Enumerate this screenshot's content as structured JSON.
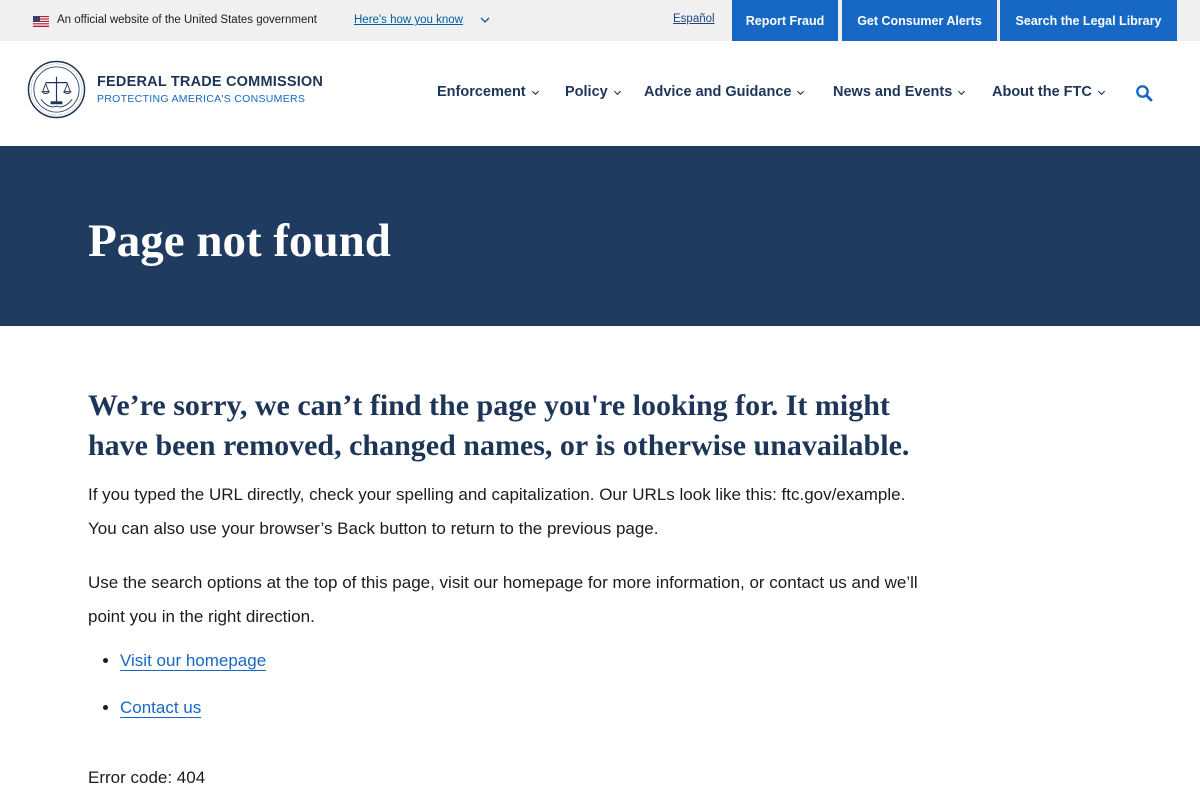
{
  "gov_banner": {
    "text": "An official website of the United States government",
    "link": "Here's how you know"
  },
  "utility": {
    "espanol": "Español",
    "report_fraud": "Report Fraud",
    "consumer_alerts": "Get Consumer Alerts",
    "legal_library": "Search the Legal Library"
  },
  "logo": {
    "title": "FEDERAL TRADE COMMISSION",
    "subtitle": "PROTECTING AMERICA'S CONSUMERS"
  },
  "nav": {
    "items": [
      {
        "label": "Enforcement"
      },
      {
        "label": "Policy"
      },
      {
        "label": "Advice and Guidance"
      },
      {
        "label": "News and Events"
      },
      {
        "label": "About the FTC"
      }
    ]
  },
  "hero": {
    "title": "Page not found"
  },
  "main": {
    "lead": "We’re sorry, we can’t find the page you're looking for. It might have been removed, changed names, or is otherwise unavailable.",
    "paragraph1": "If you typed the URL directly, check your spelling and capitalization. Our URLs look like this: ftc.gov/example. You can also use your browser’s Back button to return to the previous page.",
    "paragraph2": "Use the search options at the top of this page, visit our homepage for more information, or contact us and we’ll point you in the right direction.",
    "links": [
      {
        "label": "Visit our homepage"
      },
      {
        "label": "Contact us"
      }
    ],
    "error_code": "Error code: 404"
  },
  "colors": {
    "hero_bg": "#1f3b60",
    "utility_button": "#1668c4",
    "navy": "#1d3557"
  },
  "icons": [
    "us-flag-icon",
    "chevron-down-icon",
    "ftc-seal-logo",
    "search-icon"
  ]
}
